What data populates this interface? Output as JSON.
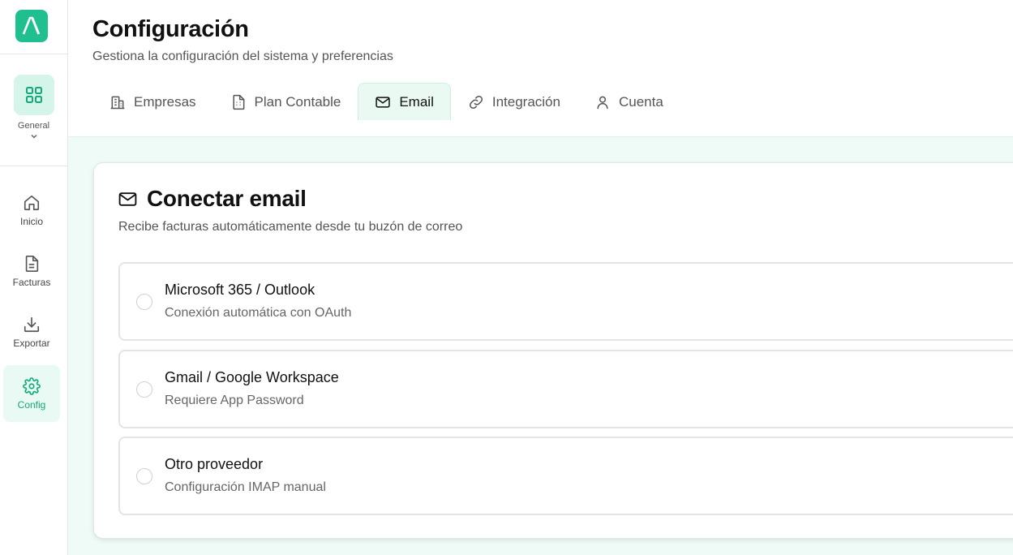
{
  "app": {
    "logo_text": "A"
  },
  "sidebar": {
    "group_label": "General",
    "items": [
      {
        "label": "Inicio",
        "icon": "home-icon"
      },
      {
        "label": "Facturas",
        "icon": "document-icon"
      },
      {
        "label": "Exportar",
        "icon": "download-icon"
      },
      {
        "label": "Config",
        "icon": "gear-icon",
        "active": true
      }
    ]
  },
  "header": {
    "title": "Configuración",
    "subtitle": "Gestiona la configuración del sistema y preferencias"
  },
  "tabs": [
    {
      "label": "Empresas",
      "icon": "building-icon"
    },
    {
      "label": "Plan Contable",
      "icon": "ledger-icon"
    },
    {
      "label": "Email",
      "icon": "mail-icon",
      "active": true
    },
    {
      "label": "Integración",
      "icon": "link-icon"
    },
    {
      "label": "Cuenta",
      "icon": "user-icon"
    }
  ],
  "email_card": {
    "title": "Conectar email",
    "subtitle": "Recibe facturas automáticamente desde tu buzón de correo",
    "options": [
      {
        "title": "Microsoft 365 / Outlook",
        "description": "Conexión automática con OAuth",
        "selected": false
      },
      {
        "title": "Gmail / Google Workspace",
        "description": "Requiere App Password",
        "selected": false
      },
      {
        "title": "Otro proveedor",
        "description": "Configuración IMAP manual",
        "selected": false
      }
    ]
  },
  "colors": {
    "accent": "#1fbf8f",
    "accent_text": "#14a97b",
    "accent_light": "#d6f5ea",
    "content_bg": "#effbf6"
  }
}
